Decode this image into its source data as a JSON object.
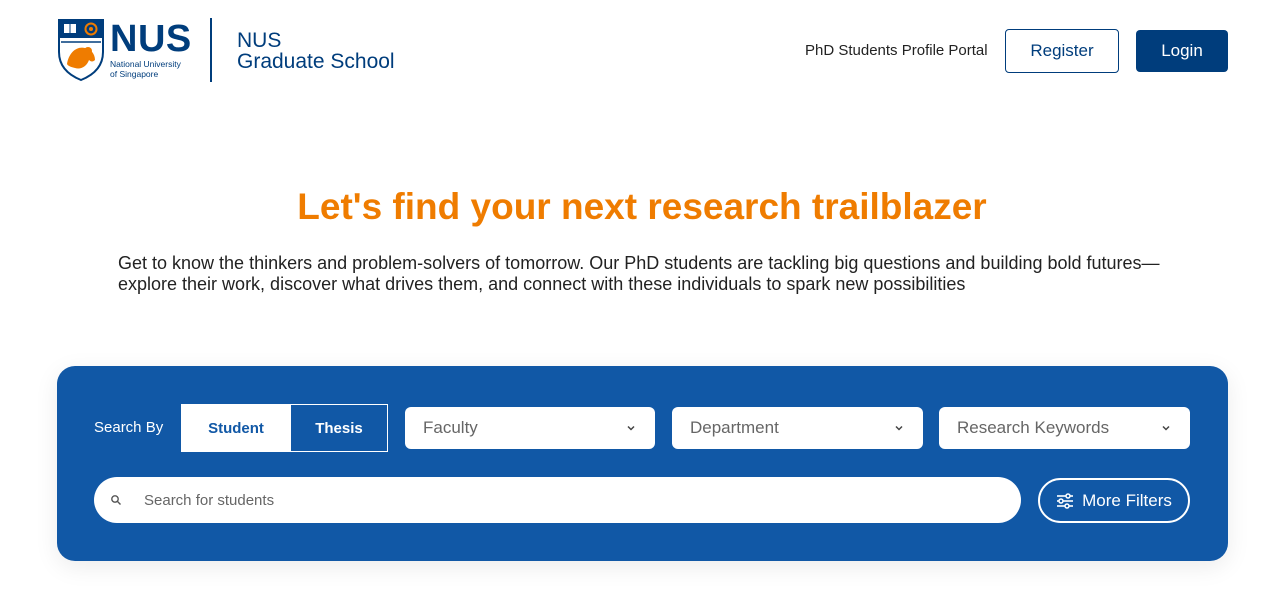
{
  "brand": {
    "logo_word": "NUS",
    "logo_subtitle_line1": "National University",
    "logo_subtitle_line2": "of Singapore",
    "school_line1": "NUS",
    "school_line2": "Graduate School",
    "primary_color": "#003d7c",
    "accent_color": "#ef7c00"
  },
  "nav": {
    "portal_label": "PhD Students Profile Portal",
    "register_label": "Register",
    "login_label": "Login"
  },
  "hero": {
    "title": "Let's find your next research trailblazer",
    "description": "Get to know the thinkers and problem-solvers of tomorrow. Our PhD students are tackling big questions and building bold futures—explore their work, discover what drives them, and connect with these individuals to spark new possibilities"
  },
  "search_panel": {
    "background_color": "#1158a6",
    "search_by_label": "Search By",
    "toggle": {
      "options": [
        "Student",
        "Thesis"
      ],
      "selected": "Student"
    },
    "filters": {
      "faculty": "Faculty",
      "department": "Department",
      "keywords": "Research Keywords",
      "chevron_icon": "chevron-down-icon"
    },
    "search": {
      "placeholder": "Search for students",
      "icon": "search-icon"
    },
    "more_filters_label": "More Filters",
    "more_filters_icon": "sliders-icon"
  }
}
